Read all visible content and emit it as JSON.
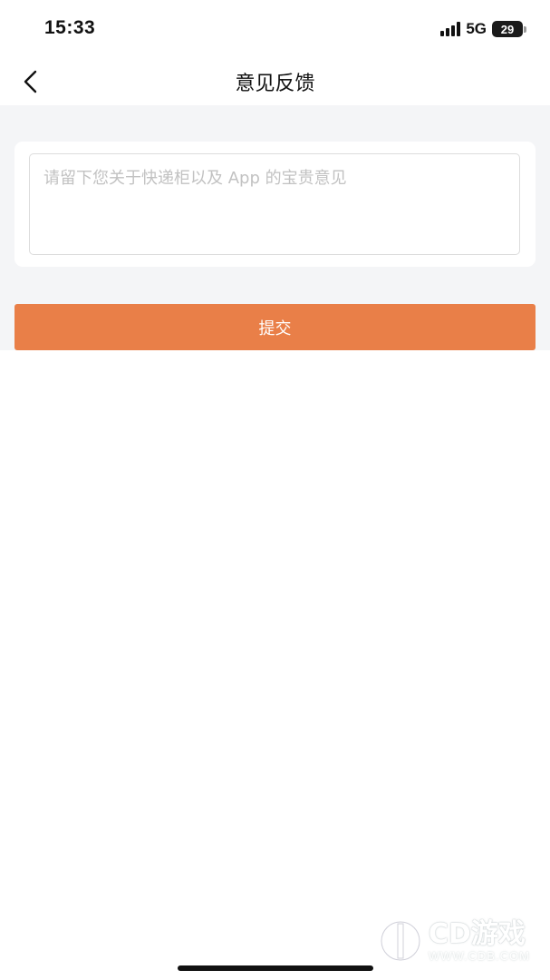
{
  "status_bar": {
    "time": "15:33",
    "network": "5G",
    "battery": "29"
  },
  "nav": {
    "back_icon": "chevron-left-icon",
    "title": "意见反馈"
  },
  "feedback": {
    "placeholder": "请留下您关于快递柜以及 App 的宝贵意见",
    "value": ""
  },
  "submit": {
    "label": "提交",
    "color": "#E97F48"
  },
  "watermark": {
    "name": "CD游戏",
    "url": "WWW.CDB.COM"
  },
  "colors": {
    "page_bg": "#F4F5F7",
    "card_bg": "#FFFFFF",
    "accent": "#E97F48"
  }
}
